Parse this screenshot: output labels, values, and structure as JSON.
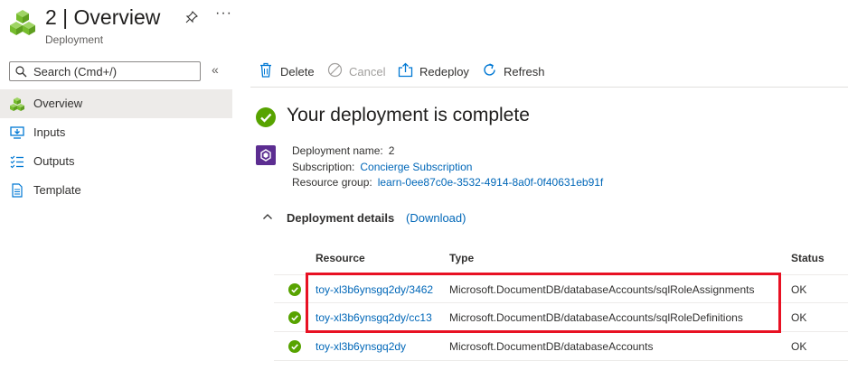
{
  "header": {
    "title": "2 | Overview",
    "subtitle": "Deployment",
    "more": "···"
  },
  "sidebar": {
    "search_placeholder": "Search (Cmd+/)",
    "collapse": "«",
    "items": [
      {
        "label": "Overview",
        "icon": "deployment-icon",
        "selected": true
      },
      {
        "label": "Inputs",
        "icon": "inputs-icon",
        "selected": false
      },
      {
        "label": "Outputs",
        "icon": "outputs-icon",
        "selected": false
      },
      {
        "label": "Template",
        "icon": "template-icon",
        "selected": false
      }
    ]
  },
  "toolbar": {
    "delete": "Delete",
    "cancel": "Cancel",
    "redeploy": "Redeploy",
    "refresh": "Refresh"
  },
  "main": {
    "status_title": "Your deployment is complete",
    "deployment_name_label": "Deployment name:",
    "deployment_name": "2",
    "subscription_label": "Subscription:",
    "subscription": "Concierge Subscription",
    "resource_group_label": "Resource group:",
    "resource_group": "learn-0ee87c0e-3532-4914-8a0f-0f40631eb91f",
    "details_label": "Deployment details",
    "download_link": "(Download)",
    "table": {
      "headers": {
        "resource": "Resource",
        "type": "Type",
        "status": "Status"
      },
      "rows": [
        {
          "resource": "toy-xl3b6ynsgq2dy/3462",
          "type": "Microsoft.DocumentDB/databaseAccounts/sqlRoleAssignments",
          "status": "OK"
        },
        {
          "resource": "toy-xl3b6ynsgq2dy/cc13",
          "type": "Microsoft.DocumentDB/databaseAccounts/sqlRoleDefinitions",
          "status": "OK"
        },
        {
          "resource": "toy-xl3b6ynsgq2dy",
          "type": "Microsoft.DocumentDB/databaseAccounts",
          "status": "OK"
        }
      ]
    }
  },
  "colors": {
    "link": "#0067b8",
    "success": "#57a300",
    "highlight": "#e81123",
    "selected_bg": "#edebe9"
  }
}
